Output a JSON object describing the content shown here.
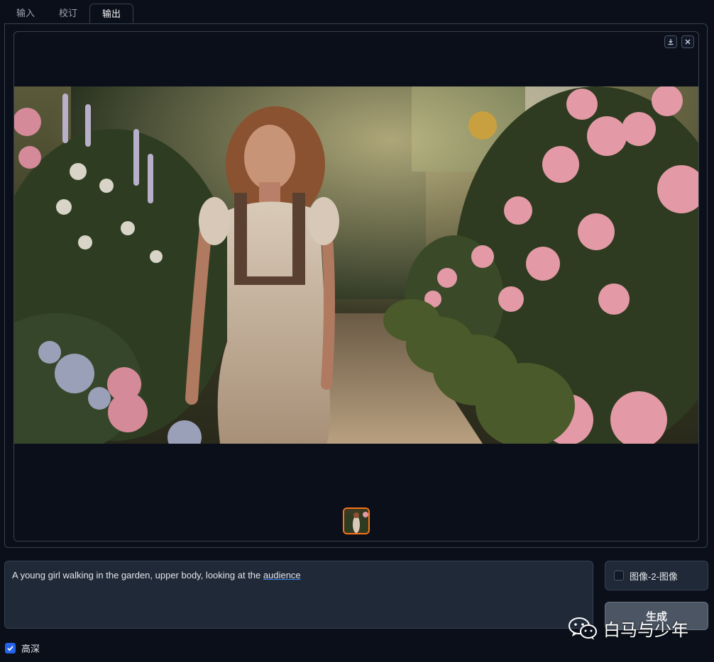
{
  "tabs": [
    {
      "label": "输入"
    },
    {
      "label": "校订"
    },
    {
      "label": "输出"
    }
  ],
  "active_tab": "输出",
  "gallery": {
    "image_subject": "girl-in-garden",
    "download_icon": "download-icon",
    "close_icon": "close-icon"
  },
  "prompt": {
    "text_before": "A young girl walking in the garden, upper body, looking at the ",
    "text_underlined": "audience"
  },
  "options": {
    "img2img_label": "图像-2-图像",
    "img2img_checked": false,
    "hd_label": "高深",
    "hd_checked": true
  },
  "generate_button": {
    "label": "生成"
  },
  "watermark": {
    "text": "白马与少年",
    "icon": "wechat-icon"
  },
  "colors": {
    "background": "#0b0f19",
    "border": "#374151",
    "accent_orange": "#f97316",
    "accent_blue": "#2563eb"
  }
}
